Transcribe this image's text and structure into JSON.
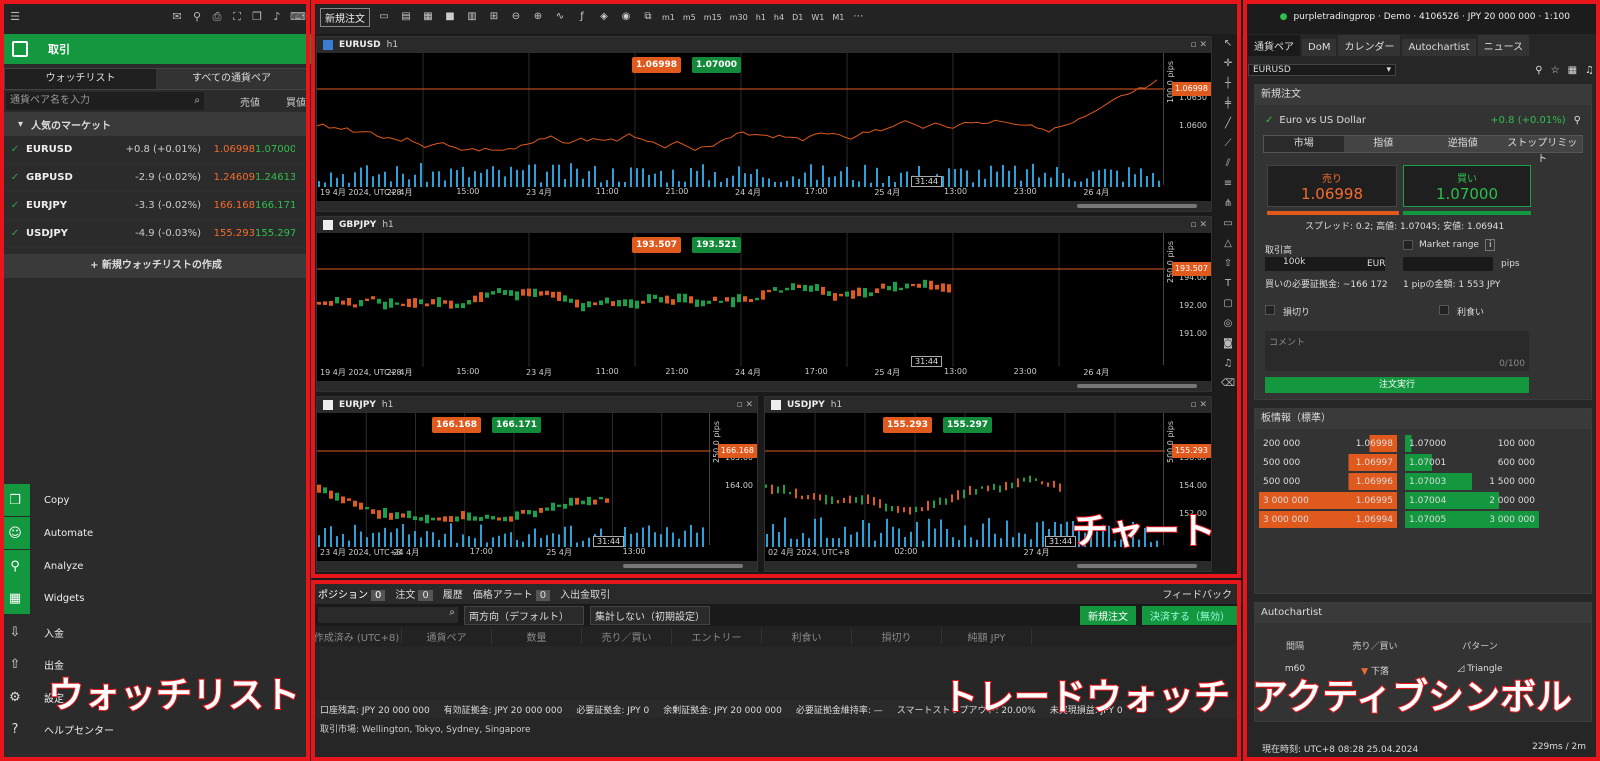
{
  "left": {
    "trade_label": "取引",
    "tabs": [
      "ウォッチリスト",
      "すべての通貨ペア"
    ],
    "search_placeholder": "通貨ペア名を入力",
    "col_bid": "売値",
    "col_ask": "買値",
    "market_header": "人気のマーケット",
    "rows": [
      {
        "sym": "EURUSD",
        "chg": "+0.8 (+0.01%)",
        "bid": "1.06998",
        "ask": "1.07000"
      },
      {
        "sym": "GBPUSD",
        "chg": "-2.9 (-0.02%)",
        "bid": "1.24609",
        "ask": "1.24613"
      },
      {
        "sym": "EURJPY",
        "chg": "-3.3 (-0.02%)",
        "bid": "166.168",
        "ask": "166.171"
      },
      {
        "sym": "USDJPY",
        "chg": "-4.9 (-0.03%)",
        "bid": "155.293",
        "ask": "155.297"
      }
    ],
    "new_watchlist": "+ 新規ウォッチリストの作成",
    "nav": [
      {
        "label": "Copy",
        "icon": "copy-icon"
      },
      {
        "label": "Automate",
        "icon": "robot-icon"
      },
      {
        "label": "Analyze",
        "icon": "analyze-icon"
      },
      {
        "label": "Widgets",
        "icon": "widgets-icon"
      },
      {
        "label": "入金",
        "icon": "deposit-icon"
      },
      {
        "label": "出金",
        "icon": "withdraw-icon"
      },
      {
        "label": "設定",
        "icon": "gear-icon"
      },
      {
        "label": "ヘルプセンター",
        "icon": "help-icon"
      }
    ]
  },
  "toolbar": {
    "new_order": "新規注文",
    "timeframes": [
      "m1",
      "m5",
      "m15",
      "m30",
      "h1",
      "h4",
      "D1",
      "W1",
      "M1"
    ]
  },
  "charts": [
    {
      "sym": "EURUSD",
      "tf": "h1",
      "sell": "1.06998",
      "buy": "1.07000",
      "price_label": "1.06998",
      "pips": "100.0 pips",
      "time": "31:44",
      "yticks": [
        "1.0650",
        "1.0600"
      ],
      "xticks": [
        "19 4月 2024, UTC+8",
        "22 4月",
        "15:00",
        "23 4月",
        "11:00",
        "21:00",
        "24 4月",
        "17:00",
        "25 4月",
        "13:00",
        "23:00",
        "26 4月"
      ]
    },
    {
      "sym": "GBPJPY",
      "tf": "h1",
      "sell": "193.507",
      "buy": "193.521",
      "price_label": "193.507",
      "pips": "250.0 pips",
      "time": "31:44",
      "yticks": [
        "194.00",
        "192.00",
        "191.00"
      ],
      "xticks": [
        "19 4月 2024, UTC+8",
        "22 4月",
        "15:00",
        "23 4月",
        "11:00",
        "21:00",
        "24 4月",
        "17:00",
        "25 4月",
        "13:00",
        "23:00",
        "26 4月"
      ]
    },
    {
      "sym": "EURJPY",
      "tf": "h1",
      "sell": "166.168",
      "buy": "166.171",
      "price_label": "166.168",
      "pips": "250.0 pips",
      "time": "31:44",
      "yticks": [
        "165.00",
        "164.00"
      ],
      "xticks": [
        "23 4月 2024, UTC+8",
        "24 4月",
        "17:00",
        "25 4月",
        "13:00"
      ]
    },
    {
      "sym": "USDJPY",
      "tf": "h1",
      "sell": "155.293",
      "buy": "155.297",
      "price_label": "155.293",
      "pips": "500.0 pips",
      "time": "31:44",
      "yticks": [
        "156.00",
        "154.00",
        "152.00"
      ],
      "xticks": [
        "02 4月 2024, UTC+8",
        "02:00",
        "27 4月"
      ]
    }
  ],
  "tradewatch": {
    "tabs": [
      {
        "label": "ポジション",
        "count": "0"
      },
      {
        "label": "注文",
        "count": "0"
      },
      {
        "label": "履歴",
        "count": ""
      },
      {
        "label": "価格アラート",
        "count": "0"
      },
      {
        "label": "入出金取引",
        "count": ""
      }
    ],
    "feedback": "フィードバック",
    "direction": "両方向（デフォルト）",
    "aggregate": "集計しない（初期設定）",
    "new_order": "新規注文",
    "close_btn": "決済する（無効）",
    "columns": [
      "作成済み (UTC+8)",
      "通貨ペア",
      "数量",
      "売り／買い",
      "エントリー",
      "利食い",
      "損切り",
      "純額 JPY"
    ],
    "account": [
      "口座残高: JPY 20 000 000",
      "有効証拠金: JPY 20 000 000",
      "必要証拠金: JPY 0",
      "余剰証拠金: JPY 20 000 000",
      "必要証拠金維持率: —",
      "スマートストップアウト: 20.00%",
      "未実現損益: JPY 0"
    ],
    "markets": "取引市場: Wellington, Tokyo, Sydney, Singapore"
  },
  "right": {
    "account": "purpletradingprop · Demo · 4106526 · JPY 20 000 000 · 1:100",
    "tabs": [
      "通貨ペア",
      "DoM",
      "カレンダー",
      "Autochartist",
      "ニュース"
    ],
    "symbol": "EURUSD",
    "new_order_header": "新規注文",
    "instrument": "Euro vs US Dollar",
    "instrument_chg": "+0.8 (+0.01%)",
    "order_tabs": [
      "市場",
      "指値",
      "逆指値",
      "ストップリミット"
    ],
    "sell_label": "売り",
    "buy_label": "買い",
    "sell_price": "1.06998",
    "buy_price": "1.07000",
    "spread": "スプレッド: 0.2; 高値: 1.07045; 安値: 1.06941",
    "volume_label": "取引高",
    "market_range": "Market range",
    "volume": "100k",
    "volume_unit": "EUR",
    "pips": "pips",
    "margin": "買いの必要証拠金: ~166 172",
    "pip_value": "1 pipの金額: 1 553 JPY",
    "stop_loss": "損切り",
    "take_profit": "利食い",
    "comment": "コメント",
    "comment_count": "0/100",
    "place_order": "注文実行",
    "depth_header": "板情報（標準）",
    "depth_bids": [
      {
        "vol": "200 000",
        "price": "1.06998"
      },
      {
        "vol": "500 000",
        "price": "1.06997"
      },
      {
        "vol": "500 000",
        "price": "1.06996"
      },
      {
        "vol": "3 000 000",
        "price": "1.06995"
      },
      {
        "vol": "3 000 000",
        "price": "1.06994"
      }
    ],
    "depth_asks": [
      {
        "price": "1.07000",
        "vol": "100 000"
      },
      {
        "price": "1.07001",
        "vol": "600 000"
      },
      {
        "price": "1.07003",
        "vol": "1 500 000"
      },
      {
        "price": "1.07004",
        "vol": "2 000 000"
      },
      {
        "price": "1.07005",
        "vol": "3 000 000"
      }
    ],
    "autochartist_header": "Autochartist",
    "ac_cols": [
      "間隔",
      "売り／買い",
      "パターン"
    ],
    "ac_row": {
      "interval": "m60",
      "dir": "下落",
      "pattern": "Triangle"
    },
    "status": "現在時刻: UTC+8 08:28 25.04.2024",
    "latency": "229ms / 2m"
  },
  "overlays": {
    "chart": "チャート",
    "watchlist": "ウォッチリスト",
    "tradewatch": "トレードウォッチ",
    "active": "アクティブシンボル"
  },
  "colors": {
    "green": "#13973f",
    "sell": "#e05a1e",
    "highlight": "#e8161b"
  }
}
